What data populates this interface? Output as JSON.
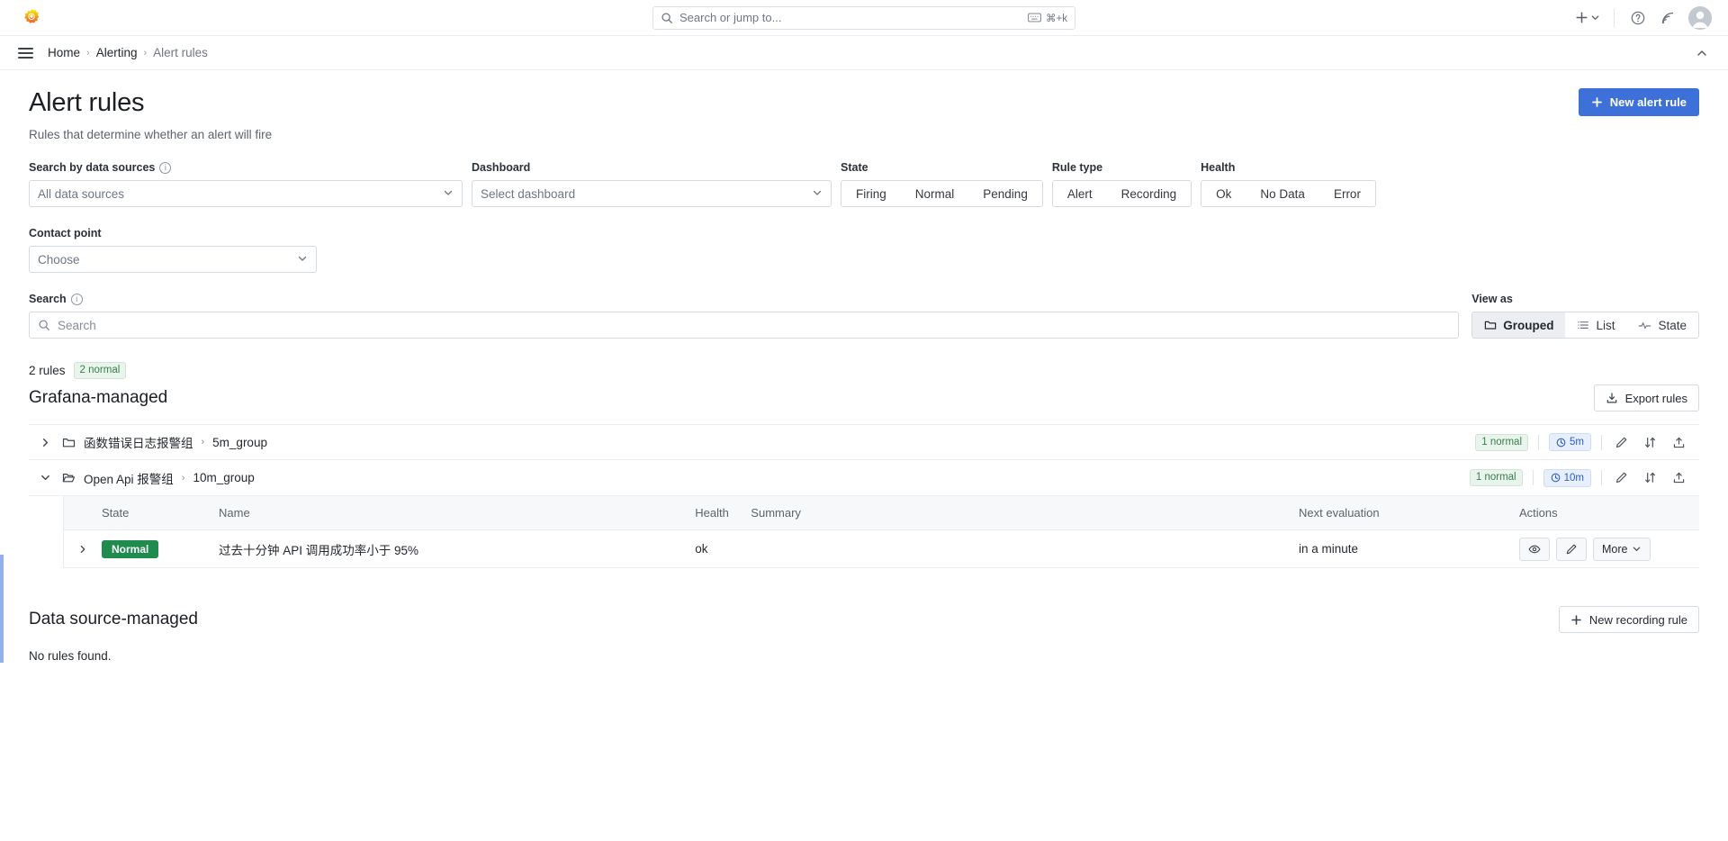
{
  "topbar": {
    "logo_icon": "grafana-logo",
    "search_placeholder": "Search or jump to...",
    "search_icon": "search-icon",
    "keyboard_icon": "keyboard-icon",
    "shortcut": "⌘+k",
    "plus_icon": "plus-icon",
    "plus_chevron_icon": "chevron-down-icon",
    "help_icon": "help-circle-icon",
    "news_icon": "news-feed-icon",
    "avatar_icon": "user-avatar"
  },
  "breadcrumb": {
    "menu_icon": "hamburger-menu-icon",
    "items": [
      {
        "label": "Home"
      },
      {
        "label": "Alerting"
      },
      {
        "label": "Alert rules"
      }
    ],
    "separator": "›",
    "collapse_icon": "chevron-up-icon"
  },
  "header": {
    "title": "Alert rules",
    "subtitle": "Rules that determine whether an alert will fire",
    "new_rule_button": "New alert rule",
    "new_rule_icon": "plus-icon"
  },
  "filters": {
    "data_sources": {
      "label": "Search by data sources",
      "info_icon": "info-circle-icon",
      "value": "All data sources",
      "chevron_icon": "chevron-down-icon"
    },
    "dashboard": {
      "label": "Dashboard",
      "placeholder": "Select dashboard",
      "chevron_icon": "chevron-down-icon"
    },
    "state": {
      "label": "State",
      "options": [
        "Firing",
        "Normal",
        "Pending"
      ],
      "selected": null
    },
    "rule_type": {
      "label": "Rule type",
      "options": [
        "Alert",
        "Recording"
      ],
      "selected": null
    },
    "health": {
      "label": "Health",
      "options": [
        "Ok",
        "No Data",
        "Error"
      ],
      "selected": null
    },
    "contact_point": {
      "label": "Contact point",
      "placeholder": "Choose",
      "chevron_icon": "chevron-down-icon"
    },
    "search": {
      "label": "Search",
      "info_icon": "info-circle-icon",
      "placeholder": "Search",
      "search_icon": "search-icon",
      "value": ""
    },
    "view_as": {
      "label": "View as",
      "options": [
        {
          "label": "Grouped",
          "icon": "folder-icon",
          "selected": true
        },
        {
          "label": "List",
          "icon": "list-icon",
          "selected": false
        },
        {
          "label": "State",
          "icon": "heart-pulse-icon",
          "selected": false
        }
      ]
    }
  },
  "summary": {
    "rules_count": "2 rules",
    "normal_badge": "2 normal"
  },
  "grafana_managed": {
    "title": "Grafana-managed",
    "export_button": "Export rules",
    "export_icon": "export-icon",
    "groups": [
      {
        "expanded": false,
        "chevron_icon": "chevron-right-icon",
        "folder_icon": "folder-icon",
        "folder_name": "函数错误日志报警组",
        "separator": "›",
        "group_name": "5m_group",
        "normal_badge": "1 normal",
        "interval_badge": "5m",
        "clock_icon": "clock-icon",
        "edit_icon": "pencil-icon",
        "reorder_icon": "reorder-icon",
        "export_icon": "export-icon"
      },
      {
        "expanded": true,
        "chevron_icon": "chevron-down-icon",
        "folder_icon": "folder-open-icon",
        "folder_name": "Open Api 报警组",
        "separator": "›",
        "group_name": "10m_group",
        "normal_badge": "1 normal",
        "interval_badge": "10m",
        "clock_icon": "clock-icon",
        "edit_icon": "pencil-icon",
        "reorder_icon": "reorder-icon",
        "export_icon": "export-icon"
      }
    ],
    "table": {
      "columns": [
        "State",
        "Name",
        "Health",
        "Summary",
        "Next evaluation",
        "Actions"
      ],
      "rows": [
        {
          "expand_icon": "chevron-right-icon",
          "state": "Normal",
          "name": "过去十分钟 API 调用成功率小于 95%",
          "health": "ok",
          "summary": "",
          "next_evaluation": "in a minute",
          "actions": {
            "view_icon": "eye-icon",
            "edit_icon": "pencil-icon",
            "more_label": "More",
            "more_chevron_icon": "chevron-down-icon"
          }
        }
      ]
    }
  },
  "data_source_managed": {
    "title": "Data source-managed",
    "new_recording_button": "New recording rule",
    "new_recording_icon": "plus-icon",
    "empty_message": "No rules found."
  },
  "colors": {
    "primary": "#3d71d9",
    "normal_green": "#1f8c4d",
    "badge_green_bg": "#e9f5ec",
    "badge_blue_bg": "#e8effc"
  }
}
